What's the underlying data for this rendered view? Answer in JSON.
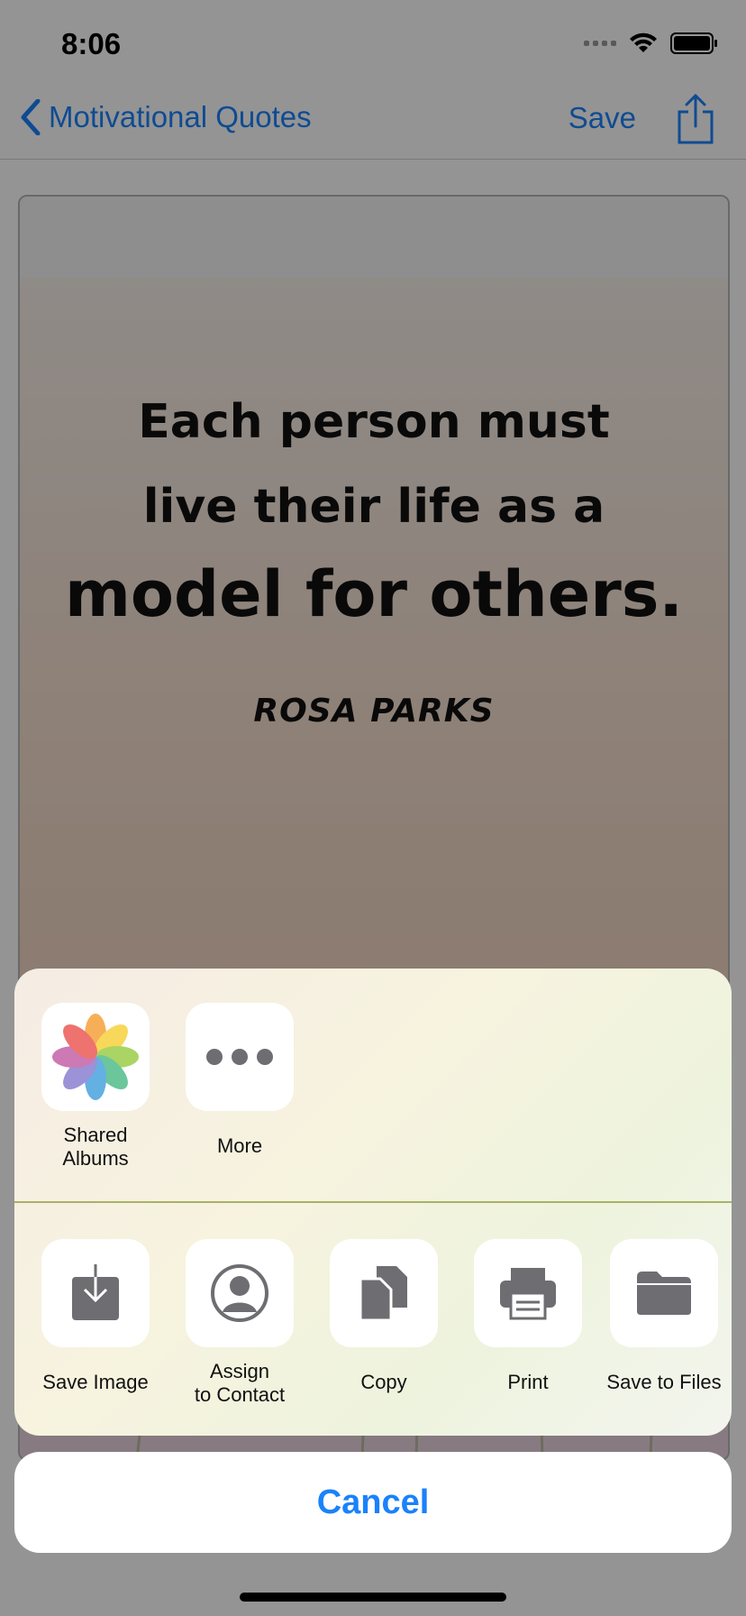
{
  "status": {
    "time": "8:06"
  },
  "nav": {
    "back_label": "Motivational Quotes",
    "save_label": "Save"
  },
  "quote": {
    "line1": "Each person must",
    "line2": "live their life as a",
    "line3": "model for others.",
    "author": "ROSA PARKS"
  },
  "share_sheet": {
    "apps": [
      {
        "label": "Shared\nAlbums",
        "icon": "photos-icon"
      },
      {
        "label": "More",
        "icon": "more-icon"
      }
    ],
    "actions": [
      {
        "label": "Save Image",
        "icon": "save-image-icon"
      },
      {
        "label": "Assign\nto Contact",
        "icon": "contact-icon"
      },
      {
        "label": "Copy",
        "icon": "copy-icon"
      },
      {
        "label": "Print",
        "icon": "print-icon"
      },
      {
        "label": "Save to Files",
        "icon": "folder-icon"
      }
    ],
    "cancel_label": "Cancel"
  },
  "colors": {
    "accent": "#1a82fb",
    "icon_gray": "#6d6d72",
    "divider": "#a9b264"
  }
}
